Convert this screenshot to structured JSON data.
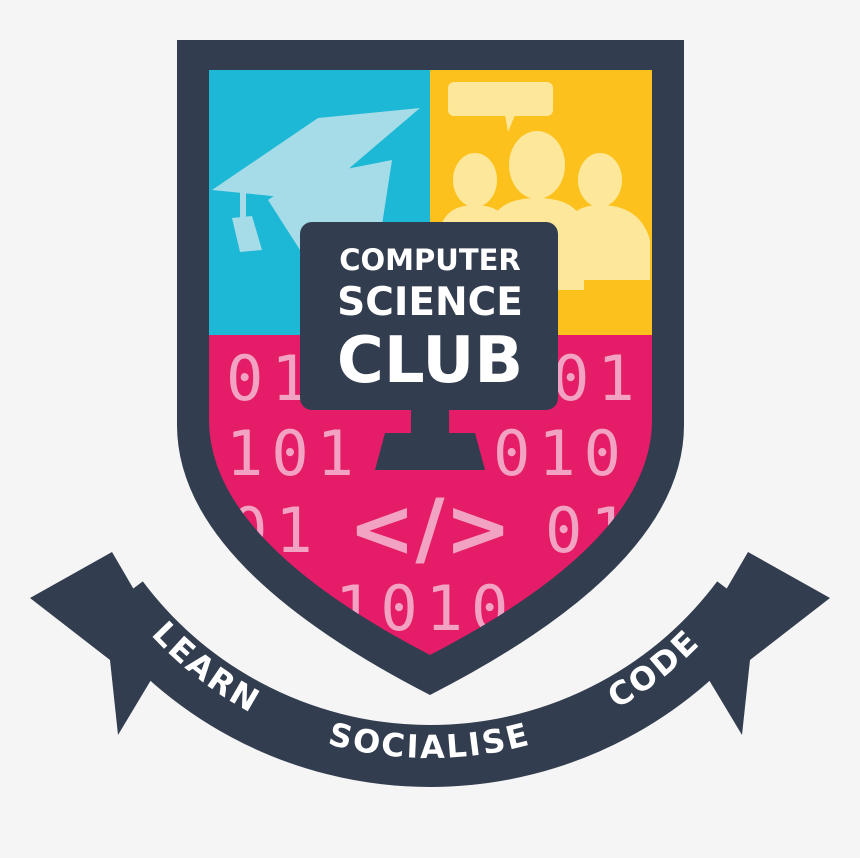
{
  "logo": {
    "title_line1": "COMPUTER",
    "title_line2": "SCIENCE",
    "title_line3": "CLUB",
    "code_symbol": "</>",
    "binary_rows": {
      "row1_left": "01",
      "row1_right": "01",
      "row2_left": "101",
      "row2_right": "010",
      "row3_left": "01",
      "row3_right": "01",
      "row4": "1010"
    },
    "banner": {
      "word1": "LEARN",
      "word2": "SOCIALISE",
      "word3": "CODE"
    },
    "icons": [
      "graduation-cap-icon",
      "group-chat-icon",
      "monitor-icon",
      "code-icon"
    ],
    "colors": {
      "dark": "#323d4f",
      "blue": "#1db8d5",
      "yellow": "#fcc11c",
      "pink": "#e51c67",
      "digit": "#f2a2c2",
      "cap": "#a6dbe8",
      "people": "#fde79a",
      "text": "#ffffff"
    }
  }
}
